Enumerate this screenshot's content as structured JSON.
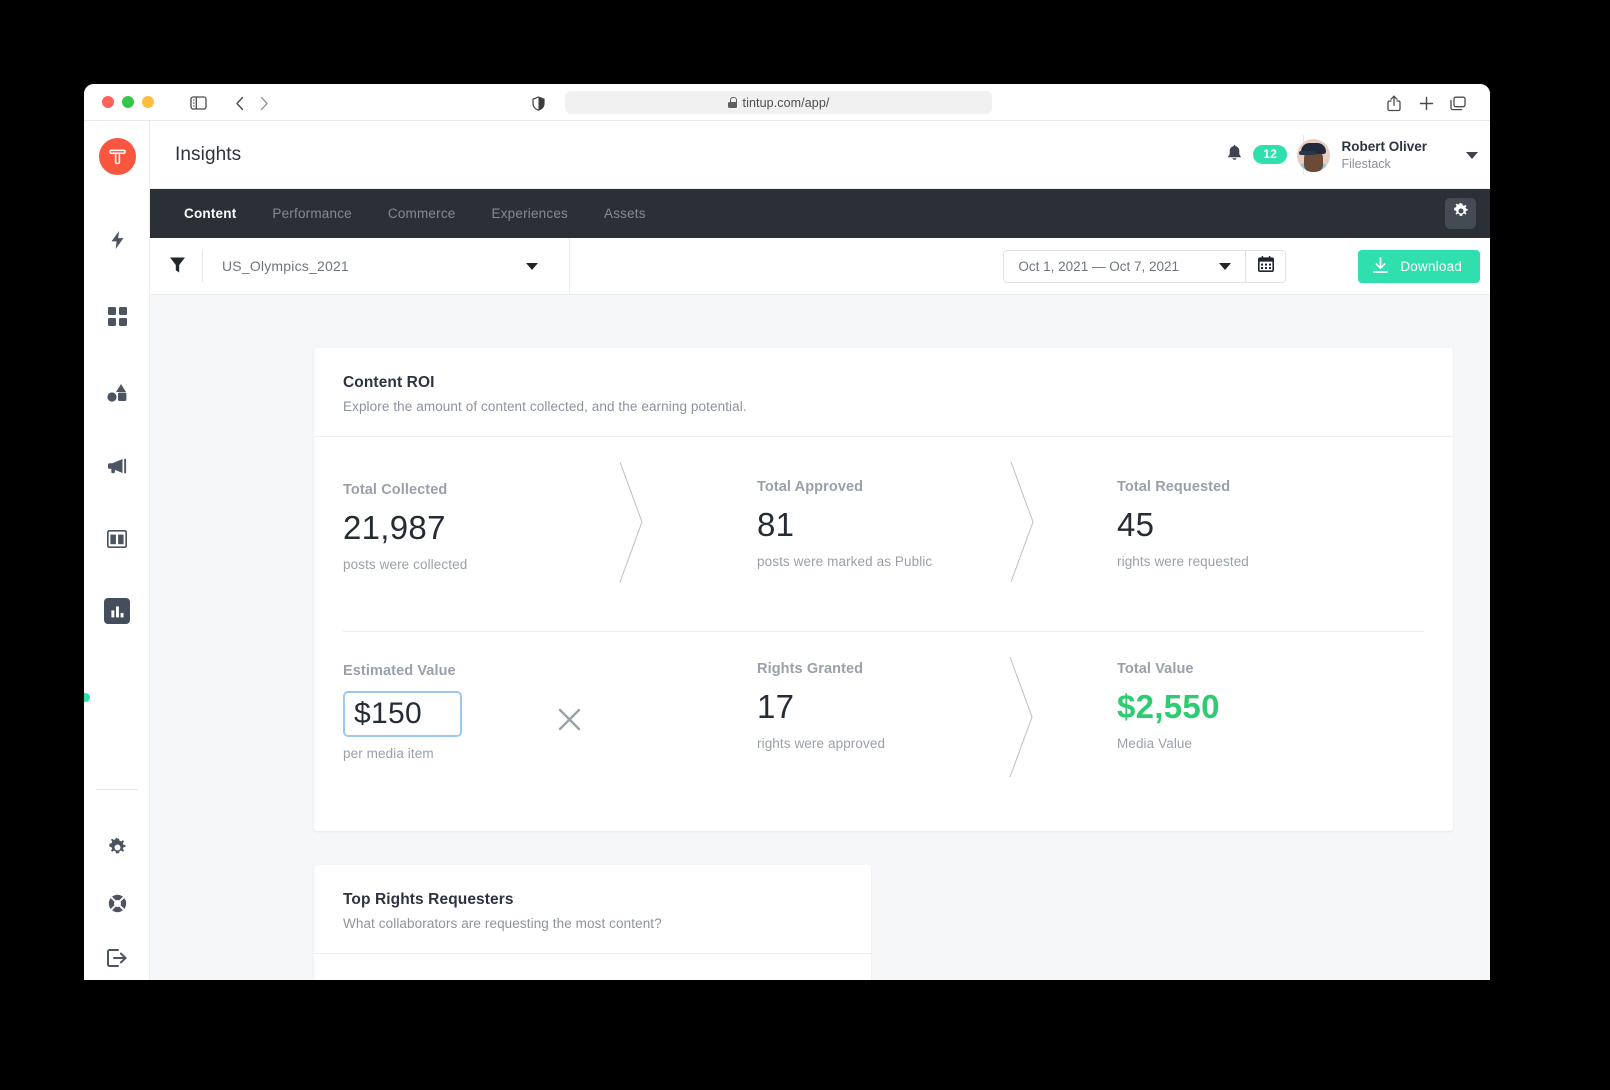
{
  "browser": {
    "url": "tintup.com/app/",
    "icons": {
      "sidebar_toggle": "sidebar-toggle-icon",
      "back": "chevron-left-icon",
      "forward": "chevron-right-icon",
      "shield": "shield-icon",
      "lock": "lock-icon",
      "share": "share-icon",
      "new_tab": "plus-icon",
      "tabs_overview": "tabs-overview-icon"
    }
  },
  "header": {
    "title": "Insights",
    "notification_count": "12",
    "user": {
      "name": "Robert Oliver",
      "org": "Filestack"
    }
  },
  "nav": {
    "tabs": [
      {
        "label": "Content",
        "active": true
      },
      {
        "label": "Performance",
        "active": false
      },
      {
        "label": "Commerce",
        "active": false
      },
      {
        "label": "Experiences",
        "active": false
      },
      {
        "label": "Assets",
        "active": false
      }
    ],
    "settings_icon": "gear-icon"
  },
  "filters": {
    "funnel_icon": "funnel-icon",
    "campaign": "US_Olympics_2021",
    "date_range": "Oct 1, 2021 — Oct 7, 2021",
    "calendar_icon": "calendar-icon",
    "download_label": "Download",
    "download_icon": "download-icon"
  },
  "sidebar": {
    "logo": "tintup-logo",
    "items": [
      {
        "name": "sidebar-item-activity",
        "icon": "lightning-bolt-icon"
      },
      {
        "name": "sidebar-item-boards",
        "icon": "grid-icon"
      },
      {
        "name": "sidebar-item-shapes",
        "icon": "shapes-icon"
      },
      {
        "name": "sidebar-item-campaigns",
        "icon": "megaphone-icon"
      },
      {
        "name": "sidebar-item-layouts",
        "icon": "columns-icon"
      },
      {
        "name": "sidebar-item-insights",
        "icon": "bar-chart-icon",
        "active": true
      }
    ],
    "bottom_items": [
      {
        "name": "sidebar-item-settings",
        "icon": "gear-icon"
      },
      {
        "name": "sidebar-item-support",
        "icon": "lifering-icon"
      },
      {
        "name": "sidebar-item-logout",
        "icon": "logout-icon"
      }
    ]
  },
  "content_roi": {
    "title": "Content ROI",
    "subtitle": "Explore the amount of content collected, and the earning potential.",
    "metrics": [
      {
        "label": "Total Collected",
        "value": "21,987",
        "caption": "posts were collected"
      },
      {
        "label": "Total Approved",
        "value": "81",
        "caption": "posts were marked as Public"
      },
      {
        "label": "Total Requested",
        "value": "45",
        "caption": "rights were requested"
      },
      {
        "label": "Estimated Value",
        "value": "$150",
        "caption": "per media item"
      },
      {
        "label": "Rights Granted",
        "value": "17",
        "caption": "rights were approved"
      },
      {
        "label": "Total Value",
        "value": "$2,550",
        "caption": "Media Value"
      }
    ],
    "multiply_icon": "multiply-icon",
    "accent_green": "#2ecc71"
  },
  "top_requesters": {
    "title": "Top Rights Requesters",
    "subtitle": "What collaborators are requesting the most content?"
  },
  "colors": {
    "brand": "#f9563f",
    "accent": "#2fe0ae",
    "navbar": "#2b2f36"
  }
}
